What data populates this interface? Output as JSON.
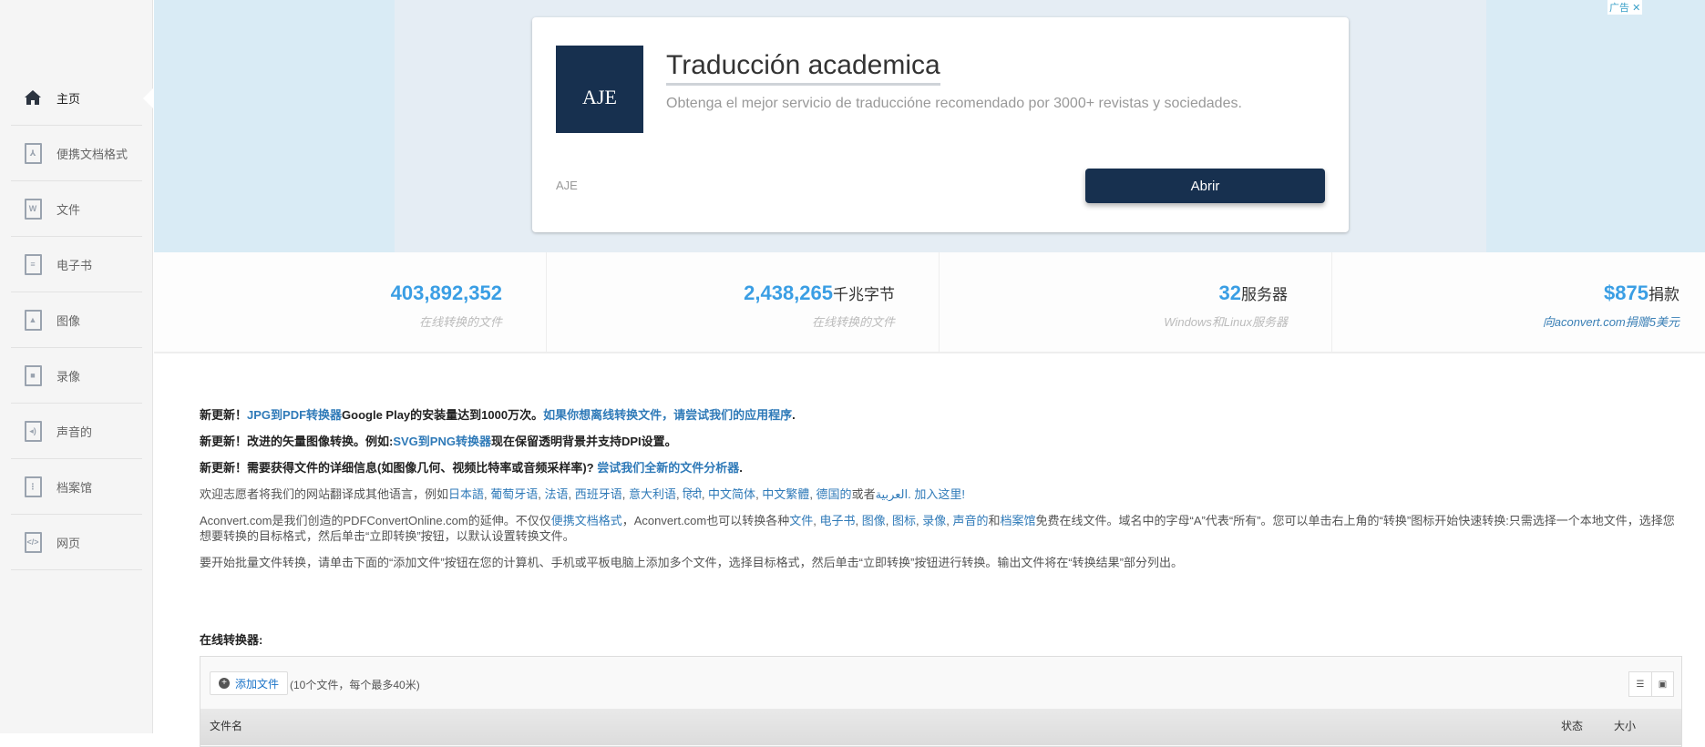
{
  "sidebar": {
    "items": [
      {
        "label": "主页",
        "icon": "home-icon"
      },
      {
        "label": "便携文档格式",
        "icon": "pdf-file-icon"
      },
      {
        "label": "文件",
        "icon": "word-file-icon"
      },
      {
        "label": "电子书",
        "icon": "ebook-file-icon"
      },
      {
        "label": "图像",
        "icon": "image-file-icon"
      },
      {
        "label": "录像",
        "icon": "video-file-icon"
      },
      {
        "label": "声音的",
        "icon": "audio-file-icon"
      },
      {
        "label": "档案馆",
        "icon": "archive-file-icon"
      },
      {
        "label": "网页",
        "icon": "webpage-file-icon"
      }
    ]
  },
  "ad": {
    "label": "广告",
    "close": "✕",
    "logo_text": "AJE",
    "title": "Traducción academica",
    "description": "Obtenga el mejor servicio de traduccióne recomendado por 3000+ revistas y sociedades.",
    "brand": "AJE",
    "button": "Abrir"
  },
  "stats": [
    {
      "value": "403,892,352",
      "unit": "",
      "sub": "在线转换的文件"
    },
    {
      "value": "2,438,265",
      "unit": "千兆字节",
      "sub": "在线转换的文件"
    },
    {
      "value": "32",
      "unit": "服务器",
      "sub": "Windows和Linux服务器"
    },
    {
      "value": "$875",
      "unit": "捐款",
      "sub": "向aconvert.com捐赠5美元"
    }
  ],
  "news": {
    "l1": {
      "a": "新更新！",
      "b": "JPG到PDF转换器",
      "c": "Google Play的安装量达到1000万次。",
      "d": "如果你想离线转换文件，请尝试我们的应用程序",
      "e": "."
    },
    "l2": {
      "a": "新更新！改进的矢量图像转换。例如:",
      "b": "SVG到PNG转换器",
      "c": "现在保留透明背景并支持DPI设置。"
    },
    "l3": {
      "a": "新更新！需要获得文件的详细信息(如图像几何、视频比特率或音频采样率)? ",
      "b": "尝试我们全新的文件分析器",
      "c": "."
    },
    "l4": {
      "a": "欢迎志愿者将我们的网站翻译成其他语言，例如",
      "langs": [
        "日本語",
        "葡萄牙语",
        "法语",
        "西班牙语",
        "意大利语",
        "हिंदी",
        "中文简体",
        "中文繁體",
        "德国的"
      ],
      "or": "或者",
      "arabic": "العربية",
      "join": ". 加入这里!"
    },
    "l5": {
      "a": "Aconvert.com是我们创造的PDFConvertOnline.com的延伸。不仅仅",
      "pdf": "便携文档格式",
      "b": "，Aconvert.com也可以转换各种",
      "types": [
        "文件",
        "电子书",
        "图像",
        "图标",
        "录像",
        "声音的"
      ],
      "and": "和",
      "archive": "档案馆",
      "c": "免费在线文件。域名中的字母“A”代表“所有”。您可以单击右上角的“转换”图标开始快速转换:只需选择一个本地文件，选择您想要转换的目标格式，然后单击“立即转换”按钮，以默认设置转换文件。"
    },
    "l6": "要开始批量文件转换，请单击下面的“添加文件”按钮在您的计算机、手机或平板电脑上添加多个文件，选择目标格式，然后单击“立即转换”按钮进行转换。输出文件将在“转换结果”部分列出。"
  },
  "converter": {
    "title": "在线转换器:",
    "add_button": "添加文件",
    "limit": "(10个文件，每个最多40米)",
    "col_name": "文件名",
    "col_status": "状态",
    "col_size": "大小"
  }
}
